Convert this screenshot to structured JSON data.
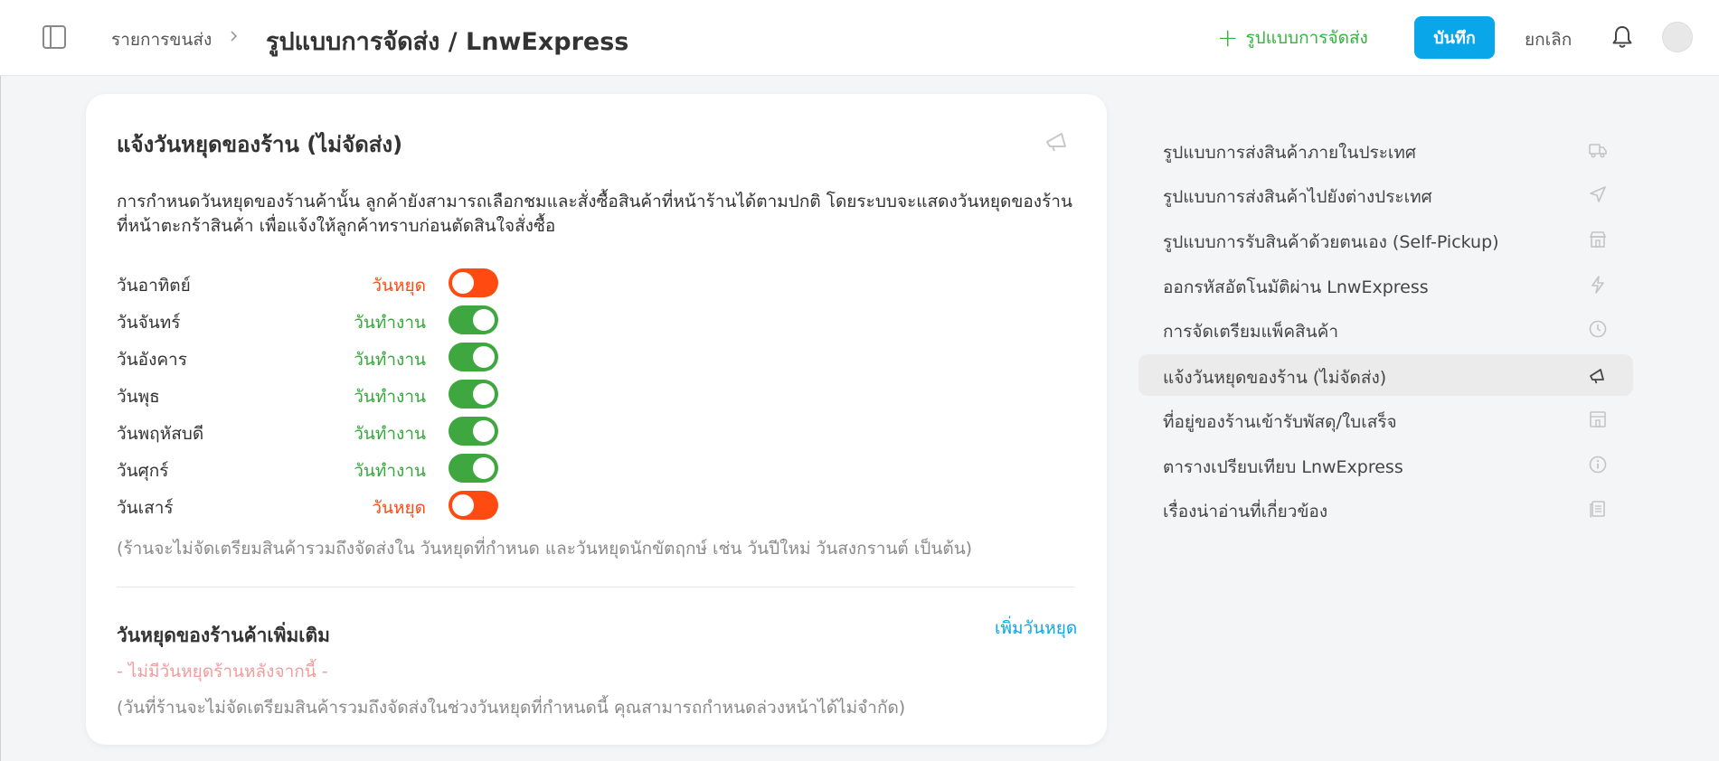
{
  "header": {
    "breadcrumb": "รายการขนส่ง",
    "title": "รูปแบบการจัดส่ง / LnwExpress",
    "add_format_label": "รูปแบบการจัดส่ง",
    "save_label": "บันทึก",
    "cancel_label": "ยกเลิก",
    "icons": [
      "sidebar-toggle-icon",
      "chevron-right-icon",
      "plus-icon",
      "bell-icon",
      "avatar"
    ]
  },
  "card": {
    "title": "แจ้งวันหยุดของร้าน (ไม่จัดส่ง)",
    "description": "การกำหนดวันหยุดของร้านค้านั้น ลูกค้ายังสามารถเลือกชมและสั่งซื้อสินค้าที่หน้าร้านได้ตามปกติ โดยระบบจะแสดงวันหยุดของร้านที่หน้าตะกร้าสินค้า เพื่อแจ้งให้ลูกค้าทราบก่อนตัดสินใจสั่งซื้อ",
    "days": [
      {
        "label": "วันอาทิตย์",
        "status": "วันหยุด",
        "working": false
      },
      {
        "label": "วันจันทร์",
        "status": "วันทำงาน",
        "working": true
      },
      {
        "label": "วันอังคาร",
        "status": "วันทำงาน",
        "working": true
      },
      {
        "label": "วันพุธ",
        "status": "วันทำงาน",
        "working": true
      },
      {
        "label": "วันพฤหัสบดี",
        "status": "วันทำงาน",
        "working": true
      },
      {
        "label": "วันศุกร์",
        "status": "วันทำงาน",
        "working": true
      },
      {
        "label": "วันเสาร์",
        "status": "วันหยุด",
        "working": false
      }
    ],
    "note": "(ร้านจะไม่จัดเตรียมสินค้ารวมถึงจัดส่งใน วันหยุดที่กำหนด และวันหยุดนักขัตฤกษ์ เช่น วันปีใหม่ วันสงกรานต์ เป็นต้น)",
    "extra_title": "วันหยุดของร้านค้าเพิ่มเติม",
    "add_holiday_label": "เพิ่มวันหยุด",
    "no_holiday": "- ไม่มีวันหยุดร้านหลังจากนี้ -",
    "extra_note": "(วันที่ร้านจะไม่จัดเตรียมสินค้ารวมถึงจัดส่งในช่วงวันหยุดที่กำหนดนี้ คุณสามารถกำหนดล่วงหน้าได้ไม่จำกัด)",
    "colors": {
      "working": "#34a83a",
      "off": "#ff4b12",
      "accent": "#0aa6ea"
    }
  },
  "right_nav": {
    "items": [
      {
        "label": "รูปแบบการส่งสินค้าภายในประเทศ",
        "icon": "truck-icon",
        "active": false
      },
      {
        "label": "รูปแบบการส่งสินค้าไปยังต่างประเทศ",
        "icon": "send-icon",
        "active": false
      },
      {
        "label": "รูปแบบการรับสินค้าด้วยตนเอง (Self-Pickup)",
        "icon": "store-icon",
        "active": false
      },
      {
        "label": "ออกรหัสอัตโนมัติผ่าน LnwExpress",
        "icon": "bolt-icon",
        "active": false
      },
      {
        "label": "การจัดเตรียมแพ็คสินค้า",
        "icon": "clock-icon",
        "active": false
      },
      {
        "label": "แจ้งวันหยุดของร้าน (ไม่จัดส่ง)",
        "icon": "megaphone-icon",
        "active": true
      },
      {
        "label": "ที่อยู่ของร้านเข้ารับพัสดุ/ใบเสร็จ",
        "icon": "building-icon",
        "active": false
      },
      {
        "label": "ตารางเปรียบเทียบ LnwExpress",
        "icon": "info-icon",
        "active": false
      },
      {
        "label": "เรื่องน่าอ่านที่เกี่ยวข้อง",
        "icon": "document-icon",
        "active": false
      }
    ]
  }
}
